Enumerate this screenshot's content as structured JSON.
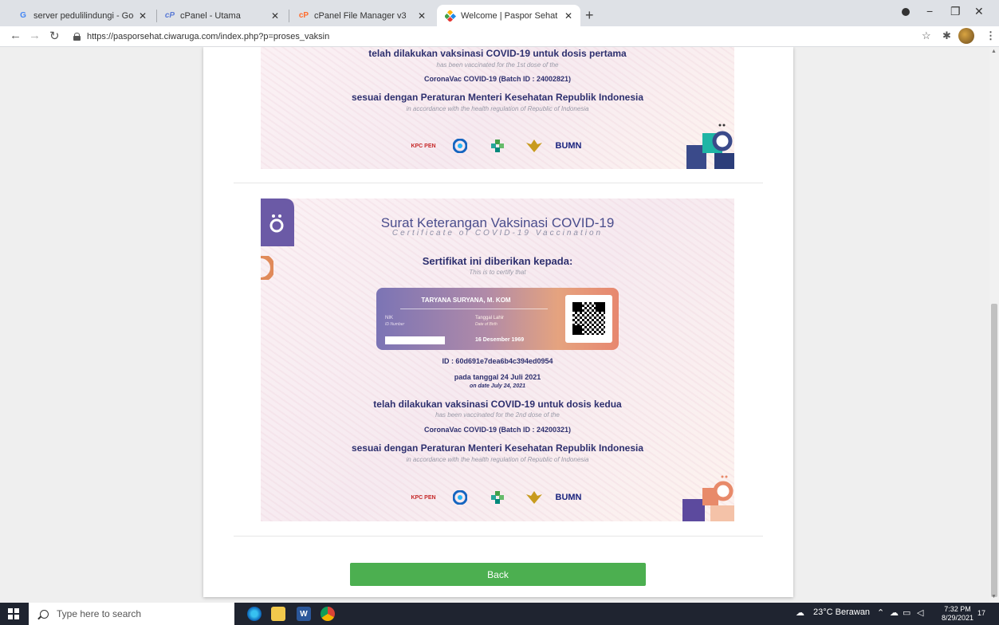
{
  "browser": {
    "tabs": [
      {
        "label": "server pedulilindungi - Google S",
        "icon": "google-icon",
        "active": false
      },
      {
        "label": "cPanel - Utama",
        "icon": "cpanel-icon",
        "active": false
      },
      {
        "label": "cPanel File Manager v3",
        "icon": "cpanel-icon",
        "active": false
      },
      {
        "label": "Welcome | Paspor Sehat",
        "icon": "paspor-sehat-icon",
        "active": true
      }
    ],
    "url": "https://pasporsehat.ciwaruga.com/index.php?p=proses_vaksin"
  },
  "certificate1": {
    "line1": "telah dilakukan vaksinasi COVID-19 untuk dosis pertama",
    "line1_en": "has been vaccinated for the 1st dose of the",
    "vaccine": "CoronaVac COVID-19 (Batch ID : 24002821)",
    "regulation": "sesuai dengan Peraturan Menteri Kesehatan Republik Indonesia",
    "regulation_en": "in accordance with the health regulation of Republic of Indonesia"
  },
  "certificate2": {
    "title": "Surat Keterangan Vaksinasi COVID-19",
    "subtitle": "Certificate of COVID-19 Vaccination",
    "given_to": "Sertifikat ini diberikan kepada:",
    "given_to_en": "This is to certify that",
    "name": "TARYANA SURYANA, M. KOM",
    "nik_label": "NIK",
    "nik_label_en": "ID Number",
    "dob_label": "Tanggal Lahir",
    "dob_label_en": "Date of Birth",
    "dob": "16 Desember 1969",
    "id": "ID : 60d691e7dea6b4c394ed0954",
    "date": "pada tanggal 24 Juli 2021",
    "date_en": "on date July 24, 2021",
    "line1": "telah dilakukan vaksinasi COVID-19 untuk dosis kedua",
    "line1_en": "has been vaccinated for the 2nd dose of the",
    "vaccine": "CoronaVac COVID-19 (Batch ID : 24200321)",
    "regulation": "sesuai dengan Peraturan Menteri Kesehatan Republik Indonesia",
    "regulation_en": "in accordance with the health regulation of Republic of Indonesia"
  },
  "logos": {
    "kpcpen": "KPC PEN",
    "kominfo": "KOMINFO",
    "kemenkes": "KEMENTERIAN KESEHATAN REPUBLIK INDONESIA",
    "bumn": "BUMN"
  },
  "back_label": "Back",
  "taskbar": {
    "search_placeholder": "Type here to search",
    "weather": "23°C  Berawan",
    "time": "7:32 PM",
    "date": "8/29/2021",
    "notifications": "17"
  },
  "colors": {
    "accent_green": "#4caf50",
    "cert_text": "#2d2f6e",
    "title_purple": "#4a4d8c"
  }
}
